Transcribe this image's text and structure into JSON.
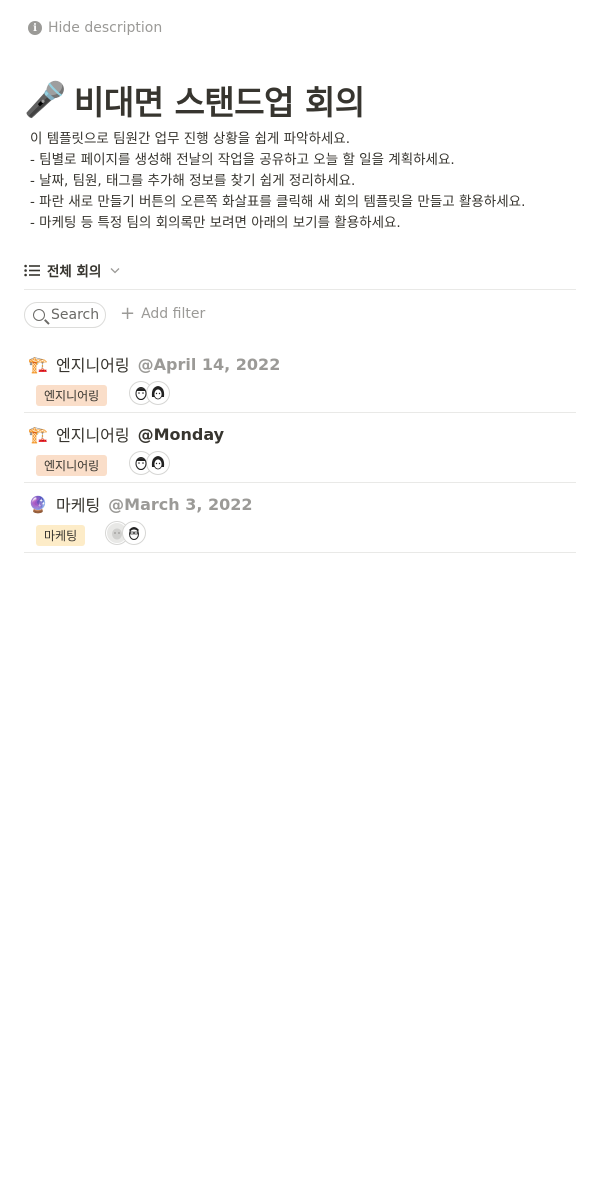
{
  "hide_description": "Hide description",
  "page": {
    "icon": "🎤",
    "title": "비대면 스탠드업 회의",
    "description": [
      "이 템플릿으로 팀원간 업무 진행 상황을 쉽게 파악하세요.",
      "- 팀별로 페이지를 생성해 전날의 작업을 공유하고 오늘 할 일을 계획하세요.",
      "- 날짜, 팀원, 태그를 추가해 정보를 찾기 쉽게 정리하세요.",
      "- 파란 새로 만들기 버튼의 오른쪽 화살표를 클릭해 새 회의 템플릿을 만들고 활용하세요.",
      "- 마케팅 등 특정 팀의 회의록만 보려면 아래의 보기를 활용하세요."
    ]
  },
  "view": {
    "label": "전체 회의",
    "icon": "list-icon"
  },
  "filters": {
    "search_label": "Search",
    "add_filter_label": "Add filter"
  },
  "rows": [
    {
      "icon": "🏗️",
      "name": "엔지니어링",
      "date": "@April 14, 2022",
      "tag": "엔지니어링",
      "tag_color": "#fadec9"
    },
    {
      "icon": "🏗️",
      "name": "엔지니어링",
      "date": "@Monday",
      "tag": "엔지니어링",
      "tag_color": "#fadec9"
    },
    {
      "icon": "🔮",
      "name": "마케팅",
      "date": "@March 3, 2022",
      "tag": "마케팅",
      "tag_color": "#fdecc8"
    }
  ],
  "colors": {
    "text": "#37352f",
    "muted": "#9b9a97",
    "divider": "#e9e9e7"
  }
}
